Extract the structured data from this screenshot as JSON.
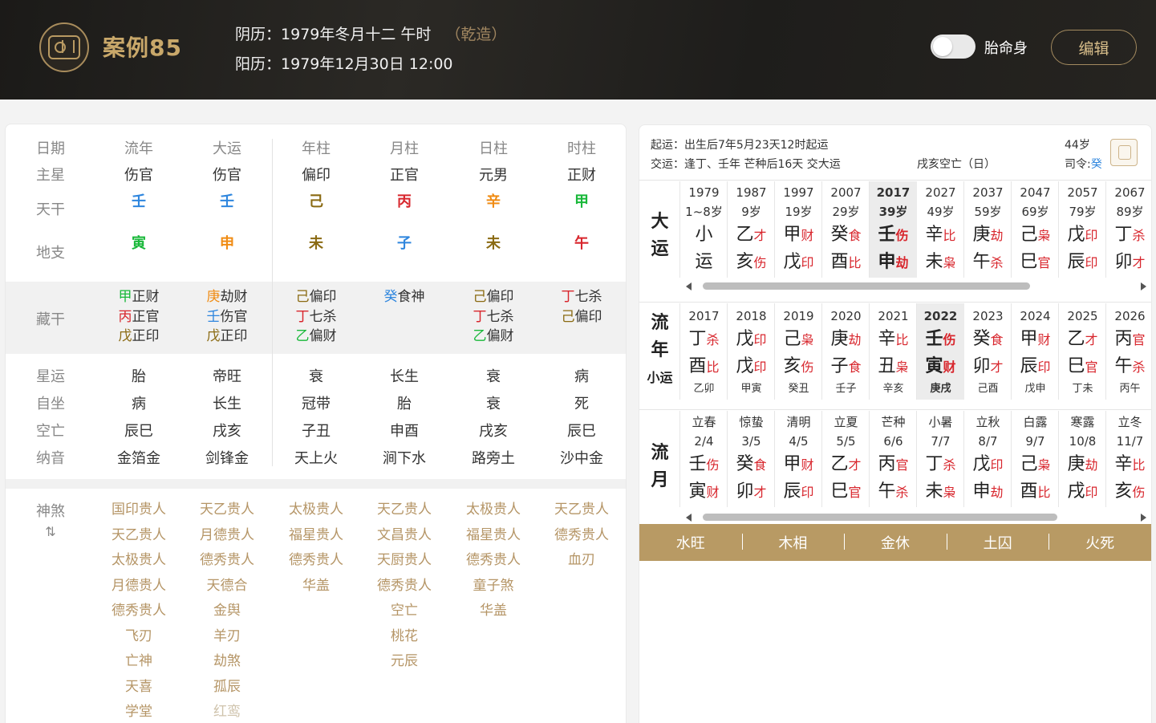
{
  "header": {
    "case_title": "案例85",
    "lunar_label": "阴历：",
    "lunar_value": "1979年冬月十二 午时",
    "gender": "（乾造）",
    "solar_label": "阳历：",
    "solar_value": "1979年12月30日 12:00",
    "toggle_label": "胎命身",
    "toggle_on": false,
    "edit_label": "编辑"
  },
  "chart": {
    "row_labels": [
      "日期",
      "主星",
      "天干",
      "地支",
      "藏干",
      "星运",
      "自坐",
      "空亡",
      "纳音",
      "神煞"
    ],
    "columns": [
      {
        "name": "流年",
        "star": "伤官",
        "gan": "壬",
        "gan_color": "#2e86de",
        "zhi": "寅",
        "zhi_color": "#19b83a",
        "hidden": [
          {
            "c": "甲",
            "cc": "#19b83a",
            "t": "正财"
          },
          {
            "c": "丙",
            "cc": "#d8262d",
            "t": "正官"
          },
          {
            "c": "戊",
            "cc": "#8a6a12",
            "t": "正印"
          }
        ],
        "xingyun": "胎",
        "zizuo": "病",
        "kongwang": "辰巳",
        "nayin": "金箔金",
        "shensha": [
          "国印贵人",
          "天乙贵人",
          "太极贵人",
          "月德贵人",
          "德秀贵人",
          "飞刃",
          "亡神",
          "天喜",
          "学堂"
        ]
      },
      {
        "name": "大运",
        "star": "伤官",
        "gan": "壬",
        "gan_color": "#2e86de",
        "zhi": "申",
        "zhi_color": "#f08c14",
        "hidden": [
          {
            "c": "庚",
            "cc": "#f08c14",
            "t": "劫财"
          },
          {
            "c": "壬",
            "cc": "#2e86de",
            "t": "伤官"
          },
          {
            "c": "戊",
            "cc": "#8a6a12",
            "t": "正印"
          }
        ],
        "xingyun": "帝旺",
        "zizuo": "长生",
        "kongwang": "戌亥",
        "nayin": "剑锋金",
        "shensha": [
          "天乙贵人",
          "月德贵人",
          "德秀贵人",
          "天德合",
          "金舆",
          "羊刃",
          "劫煞",
          "孤辰",
          "红鸾"
        ]
      },
      {
        "name": "年柱",
        "star": "偏印",
        "gan": "己",
        "gan_color": "#8a6a12",
        "zhi": "未",
        "zhi_color": "#8a6a12",
        "hidden": [
          {
            "c": "己",
            "cc": "#8a6a12",
            "t": "偏印"
          },
          {
            "c": "丁",
            "cc": "#d8262d",
            "t": "七杀"
          },
          {
            "c": "乙",
            "cc": "#19b83a",
            "t": "偏财"
          }
        ],
        "xingyun": "衰",
        "zizuo": "冠带",
        "kongwang": "子丑",
        "nayin": "天上火",
        "shensha": [
          "太极贵人",
          "福星贵人",
          "德秀贵人",
          "华盖"
        ]
      },
      {
        "name": "月柱",
        "star": "正官",
        "gan": "丙",
        "gan_color": "#d8262d",
        "zhi": "子",
        "zhi_color": "#2e86de",
        "hidden": [
          {
            "c": "癸",
            "cc": "#2e86de",
            "t": "食神"
          }
        ],
        "xingyun": "长生",
        "zizuo": "胎",
        "kongwang": "申酉",
        "nayin": "涧下水",
        "shensha": [
          "天乙贵人",
          "文昌贵人",
          "天厨贵人",
          "德秀贵人",
          "空亡",
          "桃花",
          "元辰"
        ]
      },
      {
        "name": "日柱",
        "star": "元男",
        "gan": "辛",
        "gan_color": "#f08c14",
        "zhi": "未",
        "zhi_color": "#8a6a12",
        "hidden": [
          {
            "c": "己",
            "cc": "#8a6a12",
            "t": "偏印"
          },
          {
            "c": "丁",
            "cc": "#d8262d",
            "t": "七杀"
          },
          {
            "c": "乙",
            "cc": "#19b83a",
            "t": "偏财"
          }
        ],
        "xingyun": "衰",
        "zizuo": "衰",
        "kongwang": "戌亥",
        "nayin": "路旁土",
        "shensha": [
          "太极贵人",
          "福星贵人",
          "德秀贵人",
          "童子煞",
          "华盖"
        ]
      },
      {
        "name": "时柱",
        "star": "正财",
        "gan": "甲",
        "gan_color": "#19b83a",
        "zhi": "午",
        "zhi_color": "#d8262d",
        "hidden": [
          {
            "c": "丁",
            "cc": "#d8262d",
            "t": "七杀"
          },
          {
            "c": "己",
            "cc": "#8a6a12",
            "t": "偏印"
          }
        ],
        "xingyun": "病",
        "zizuo": "死",
        "kongwang": "辰巳",
        "nayin": "沙中金",
        "shensha": [
          "天乙贵人",
          "德秀贵人",
          "血刃"
        ]
      }
    ],
    "shensha_toggle": "⇅"
  },
  "fortune": {
    "qiyun_label": "起运：",
    "qiyun_value": "出生后7年5月23天12时起运",
    "jiaoyun_label": "交运：",
    "jiaoyun_value": "逢丁、壬年 芒种后16天 交大运",
    "age": "44岁",
    "kongwang": "戌亥空亡（日）",
    "siling_label": "司令:",
    "siling_value": "癸",
    "dayun_label": [
      "大",
      "运"
    ],
    "dayun": [
      {
        "year": "1979",
        "age": "1~8岁",
        "g": "小",
        "gs": "",
        "z": "运",
        "zs": ""
      },
      {
        "year": "1987",
        "age": "9岁",
        "g": "乙",
        "gs": "才",
        "z": "亥",
        "zs": "伤"
      },
      {
        "year": "1997",
        "age": "19岁",
        "g": "甲",
        "gs": "财",
        "z": "戊",
        "zs": "印"
      },
      {
        "year": "2007",
        "age": "29岁",
        "g": "癸",
        "gs": "食",
        "z": "酉",
        "zs": "比"
      },
      {
        "year": "2017",
        "age": "39岁",
        "g": "壬",
        "gs": "伤",
        "z": "申",
        "zs": "劫"
      },
      {
        "year": "2027",
        "age": "49岁",
        "g": "辛",
        "gs": "比",
        "z": "未",
        "zs": "枭"
      },
      {
        "year": "2037",
        "age": "59岁",
        "g": "庚",
        "gs": "劫",
        "z": "午",
        "zs": "杀"
      },
      {
        "year": "2047",
        "age": "69岁",
        "g": "己",
        "gs": "枭",
        "z": "巳",
        "zs": "官"
      },
      {
        "year": "2057",
        "age": "79岁",
        "g": "戊",
        "gs": "印",
        "z": "辰",
        "zs": "印"
      },
      {
        "year": "2067",
        "age": "89岁",
        "g": "丁",
        "gs": "杀",
        "z": "卯",
        "zs": "才"
      }
    ],
    "liunian_label": [
      "流",
      "年"
    ],
    "xiaoyun_label": "小运",
    "liunian": [
      {
        "year": "2017",
        "g": "丁",
        "gs": "杀",
        "z": "酉",
        "zs": "比",
        "xy": "乙卯"
      },
      {
        "year": "2018",
        "g": "戊",
        "gs": "印",
        "z": "戊",
        "zs": "印",
        "xy": "甲寅"
      },
      {
        "year": "2019",
        "g": "己",
        "gs": "枭",
        "z": "亥",
        "zs": "伤",
        "xy": "癸丑"
      },
      {
        "year": "2020",
        "g": "庚",
        "gs": "劫",
        "z": "子",
        "zs": "食",
        "xy": "壬子"
      },
      {
        "year": "2021",
        "g": "辛",
        "gs": "比",
        "z": "丑",
        "zs": "枭",
        "xy": "辛亥"
      },
      {
        "year": "2022",
        "g": "壬",
        "gs": "伤",
        "z": "寅",
        "zs": "财",
        "xy": "庚戌"
      },
      {
        "year": "2023",
        "g": "癸",
        "gs": "食",
        "z": "卯",
        "zs": "才",
        "xy": "己酉"
      },
      {
        "year": "2024",
        "g": "甲",
        "gs": "财",
        "z": "辰",
        "zs": "印",
        "xy": "戊申"
      },
      {
        "year": "2025",
        "g": "乙",
        "gs": "才",
        "z": "巳",
        "zs": "官",
        "xy": "丁未"
      },
      {
        "year": "2026",
        "g": "丙",
        "gs": "官",
        "z": "午",
        "zs": "杀",
        "xy": "丙午"
      }
    ],
    "liuyue_label": [
      "流",
      "月"
    ],
    "liuyue": [
      {
        "term": "立春",
        "date": "2/4",
        "g": "壬",
        "gs": "伤",
        "z": "寅",
        "zs": "财"
      },
      {
        "term": "惊蛰",
        "date": "3/5",
        "g": "癸",
        "gs": "食",
        "z": "卯",
        "zs": "才"
      },
      {
        "term": "清明",
        "date": "4/5",
        "g": "甲",
        "gs": "财",
        "z": "辰",
        "zs": "印"
      },
      {
        "term": "立夏",
        "date": "5/5",
        "g": "乙",
        "gs": "才",
        "z": "巳",
        "zs": "官"
      },
      {
        "term": "芒种",
        "date": "6/6",
        "g": "丙",
        "gs": "官",
        "z": "午",
        "zs": "杀"
      },
      {
        "term": "小暑",
        "date": "7/7",
        "g": "丁",
        "gs": "杀",
        "z": "未",
        "zs": "枭"
      },
      {
        "term": "立秋",
        "date": "8/7",
        "g": "戊",
        "gs": "印",
        "z": "申",
        "zs": "劫"
      },
      {
        "term": "白露",
        "date": "9/7",
        "g": "己",
        "gs": "枭",
        "z": "酉",
        "zs": "比"
      },
      {
        "term": "寒露",
        "date": "10/8",
        "g": "庚",
        "gs": "劫",
        "z": "戌",
        "zs": "印"
      },
      {
        "term": "立冬",
        "date": "11/7",
        "g": "辛",
        "gs": "比",
        "z": "亥",
        "zs": "伤"
      }
    ],
    "elements": [
      "水旺",
      "木相",
      "金休",
      "土囚",
      "火死"
    ]
  },
  "colors": {
    "accent": "#b89a64",
    "label_red": "#d8262d",
    "shensha": "#b59566",
    "siling": "#2e86de"
  }
}
